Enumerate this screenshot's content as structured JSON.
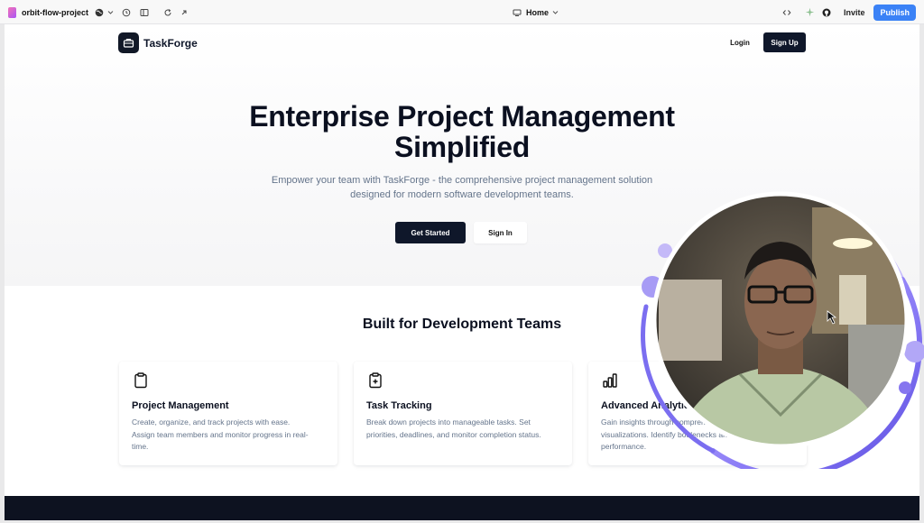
{
  "editor": {
    "project_name": "orbit-flow-project",
    "page_selector": "Home",
    "invite_label": "Invite",
    "publish_label": "Publish",
    "accent": "#3b82f6"
  },
  "site": {
    "brand_name": "TaskForge",
    "nav": {
      "login": "Login",
      "signup": "Sign Up"
    },
    "hero": {
      "title_line1": "Enterprise Project Management",
      "title_line2": "Simplified",
      "subtitle_line1": "Empower your team with TaskForge - the comprehensive project management solution",
      "subtitle_line2": "designed for modern software development teams.",
      "cta_primary": "Get Started",
      "cta_secondary": "Sign In"
    },
    "features_title": "Built for Development Teams",
    "features": [
      {
        "icon": "clipboard-icon",
        "title": "Project Management",
        "desc_lines": [
          "Create, organize, and track projects with ease.",
          "Assign team members and monitor progress in real-",
          "time."
        ]
      },
      {
        "icon": "clipboard-plus-icon",
        "title": "Task Tracking",
        "desc_lines": [
          "Break down projects into manageable tasks. Set",
          "priorities, deadlines, and monitor completion status."
        ]
      },
      {
        "icon": "bar-chart-icon",
        "title": "Advanced Analytics",
        "desc_lines": [
          "Gain insights through comprehensive",
          "visualizations. Identify bottlenecks and",
          "performance."
        ]
      }
    ]
  }
}
